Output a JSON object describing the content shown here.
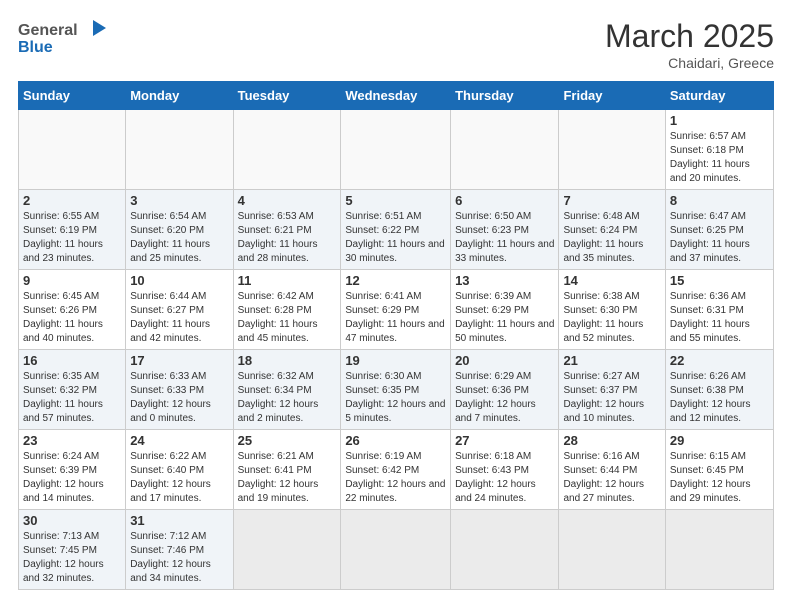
{
  "header": {
    "logo_general": "General",
    "logo_blue": "Blue",
    "month_year": "March 2025",
    "location": "Chaidari, Greece"
  },
  "days_of_week": [
    "Sunday",
    "Monday",
    "Tuesday",
    "Wednesday",
    "Thursday",
    "Friday",
    "Saturday"
  ],
  "weeks": [
    [
      {
        "day": "",
        "info": ""
      },
      {
        "day": "",
        "info": ""
      },
      {
        "day": "",
        "info": ""
      },
      {
        "day": "",
        "info": ""
      },
      {
        "day": "",
        "info": ""
      },
      {
        "day": "",
        "info": ""
      },
      {
        "day": "1",
        "info": "Sunrise: 6:57 AM\nSunset: 6:18 PM\nDaylight: 11 hours and 20 minutes."
      }
    ],
    [
      {
        "day": "2",
        "info": "Sunrise: 6:55 AM\nSunset: 6:19 PM\nDaylight: 11 hours and 23 minutes."
      },
      {
        "day": "3",
        "info": "Sunrise: 6:54 AM\nSunset: 6:20 PM\nDaylight: 11 hours and 25 minutes."
      },
      {
        "day": "4",
        "info": "Sunrise: 6:53 AM\nSunset: 6:21 PM\nDaylight: 11 hours and 28 minutes."
      },
      {
        "day": "5",
        "info": "Sunrise: 6:51 AM\nSunset: 6:22 PM\nDaylight: 11 hours and 30 minutes."
      },
      {
        "day": "6",
        "info": "Sunrise: 6:50 AM\nSunset: 6:23 PM\nDaylight: 11 hours and 33 minutes."
      },
      {
        "day": "7",
        "info": "Sunrise: 6:48 AM\nSunset: 6:24 PM\nDaylight: 11 hours and 35 minutes."
      },
      {
        "day": "8",
        "info": "Sunrise: 6:47 AM\nSunset: 6:25 PM\nDaylight: 11 hours and 37 minutes."
      }
    ],
    [
      {
        "day": "9",
        "info": "Sunrise: 6:45 AM\nSunset: 6:26 PM\nDaylight: 11 hours and 40 minutes."
      },
      {
        "day": "10",
        "info": "Sunrise: 6:44 AM\nSunset: 6:27 PM\nDaylight: 11 hours and 42 minutes."
      },
      {
        "day": "11",
        "info": "Sunrise: 6:42 AM\nSunset: 6:28 PM\nDaylight: 11 hours and 45 minutes."
      },
      {
        "day": "12",
        "info": "Sunrise: 6:41 AM\nSunset: 6:29 PM\nDaylight: 11 hours and 47 minutes."
      },
      {
        "day": "13",
        "info": "Sunrise: 6:39 AM\nSunset: 6:29 PM\nDaylight: 11 hours and 50 minutes."
      },
      {
        "day": "14",
        "info": "Sunrise: 6:38 AM\nSunset: 6:30 PM\nDaylight: 11 hours and 52 minutes."
      },
      {
        "day": "15",
        "info": "Sunrise: 6:36 AM\nSunset: 6:31 PM\nDaylight: 11 hours and 55 minutes."
      }
    ],
    [
      {
        "day": "16",
        "info": "Sunrise: 6:35 AM\nSunset: 6:32 PM\nDaylight: 11 hours and 57 minutes."
      },
      {
        "day": "17",
        "info": "Sunrise: 6:33 AM\nSunset: 6:33 PM\nDaylight: 12 hours and 0 minutes."
      },
      {
        "day": "18",
        "info": "Sunrise: 6:32 AM\nSunset: 6:34 PM\nDaylight: 12 hours and 2 minutes."
      },
      {
        "day": "19",
        "info": "Sunrise: 6:30 AM\nSunset: 6:35 PM\nDaylight: 12 hours and 5 minutes."
      },
      {
        "day": "20",
        "info": "Sunrise: 6:29 AM\nSunset: 6:36 PM\nDaylight: 12 hours and 7 minutes."
      },
      {
        "day": "21",
        "info": "Sunrise: 6:27 AM\nSunset: 6:37 PM\nDaylight: 12 hours and 10 minutes."
      },
      {
        "day": "22",
        "info": "Sunrise: 6:26 AM\nSunset: 6:38 PM\nDaylight: 12 hours and 12 minutes."
      }
    ],
    [
      {
        "day": "23",
        "info": "Sunrise: 6:24 AM\nSunset: 6:39 PM\nDaylight: 12 hours and 14 minutes."
      },
      {
        "day": "24",
        "info": "Sunrise: 6:22 AM\nSunset: 6:40 PM\nDaylight: 12 hours and 17 minutes."
      },
      {
        "day": "25",
        "info": "Sunrise: 6:21 AM\nSunset: 6:41 PM\nDaylight: 12 hours and 19 minutes."
      },
      {
        "day": "26",
        "info": "Sunrise: 6:19 AM\nSunset: 6:42 PM\nDaylight: 12 hours and 22 minutes."
      },
      {
        "day": "27",
        "info": "Sunrise: 6:18 AM\nSunset: 6:43 PM\nDaylight: 12 hours and 24 minutes."
      },
      {
        "day": "28",
        "info": "Sunrise: 6:16 AM\nSunset: 6:44 PM\nDaylight: 12 hours and 27 minutes."
      },
      {
        "day": "29",
        "info": "Sunrise: 6:15 AM\nSunset: 6:45 PM\nDaylight: 12 hours and 29 minutes."
      }
    ],
    [
      {
        "day": "30",
        "info": "Sunrise: 7:13 AM\nSunset: 7:45 PM\nDaylight: 12 hours and 32 minutes."
      },
      {
        "day": "31",
        "info": "Sunrise: 7:12 AM\nSunset: 7:46 PM\nDaylight: 12 hours and 34 minutes."
      },
      {
        "day": "",
        "info": ""
      },
      {
        "day": "",
        "info": ""
      },
      {
        "day": "",
        "info": ""
      },
      {
        "day": "",
        "info": ""
      },
      {
        "day": "",
        "info": ""
      }
    ]
  ]
}
